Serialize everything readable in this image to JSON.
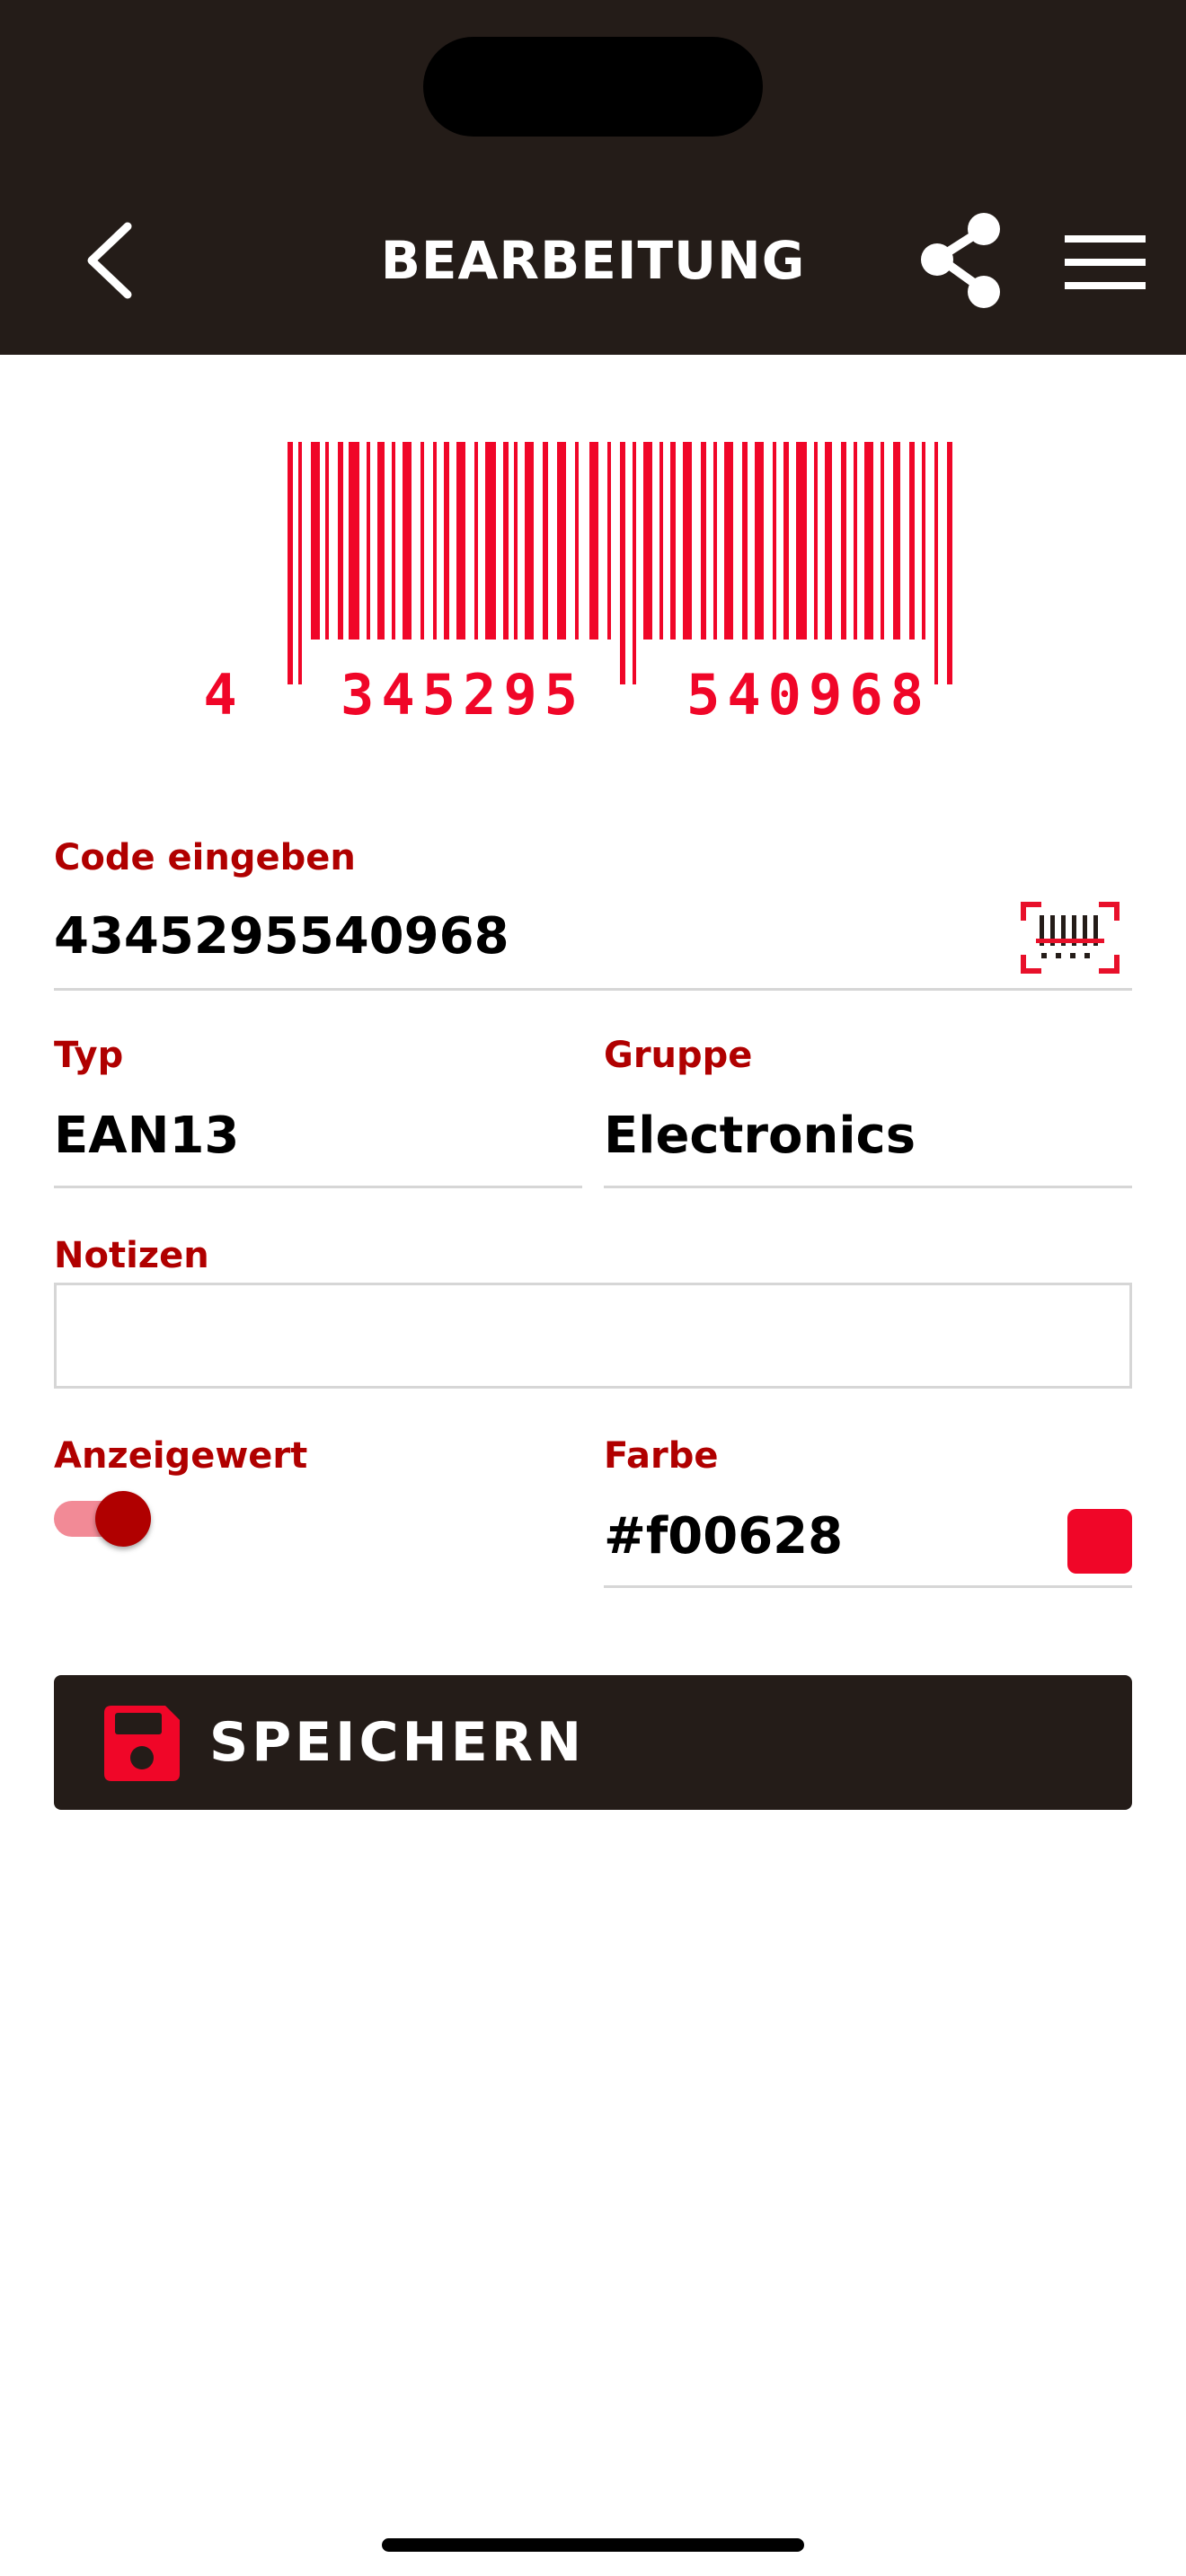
{
  "header": {
    "title": "BEARBEITUNG",
    "icons": [
      "back-icon",
      "share-icon",
      "menu-icon"
    ]
  },
  "barcode": {
    "digits_first": "4",
    "digits_left": "345295",
    "digits_right": "540968",
    "color": "#f00628"
  },
  "code_field": {
    "label": "Code eingeben",
    "value": "4345295540968",
    "icon": "barcode-scan-icon"
  },
  "type_field": {
    "label": "Typ",
    "value": "EAN13"
  },
  "group_field": {
    "label": "Gruppe",
    "value": "Electronics"
  },
  "notes_field": {
    "label": "Notizen",
    "value": ""
  },
  "display_value": {
    "label": "Anzeigewert",
    "enabled": true
  },
  "color_field": {
    "label": "Farbe",
    "value": "#f00628"
  },
  "save_button": {
    "label": "SPEICHERN",
    "icon": "floppy-disk-icon"
  },
  "colors": {
    "header_bg": "#241c18",
    "accent_label": "#b00000",
    "barcode": "#f00628",
    "toggle_track": "#f28a96"
  }
}
